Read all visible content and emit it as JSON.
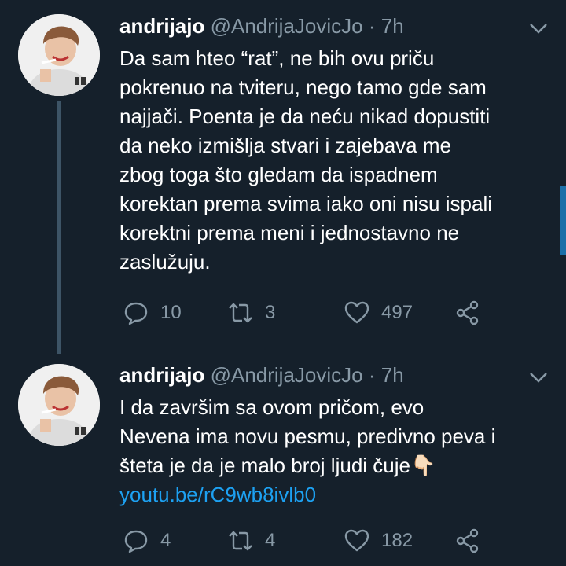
{
  "tweets": [
    {
      "name": "andrijajo",
      "handle": "@AndrijaJovicJo",
      "separator": "·",
      "time": "7h",
      "lines": [
        "Da sam hteo “rat”, ne bih ovu priču",
        "pokrenuo na tviteru, nego tamo gde sam",
        "najjači. Poenta je da neću nikad dopustiti",
        "da neko izmišlja stvari i zajebava me",
        "zbog toga što gledam da ispadnem",
        "korektan prema svima iako oni nisu ispali",
        "korektni prema meni i jednostavno ne",
        "zaslužuju."
      ],
      "replies": "10",
      "retweets": "3",
      "likes": "497"
    },
    {
      "name": "andrijajo",
      "handle": "@AndrijaJovicJo",
      "separator": "·",
      "time": "7h",
      "lines": [
        "I da završim sa ovom pričom, evo",
        "Nevena ima novu pesmu, predivno peva i",
        "šteta je da je malo broj ljudi čuje"
      ],
      "emoji": "👇🏻",
      "link": "youtu.be/rC9wb8ivlb0",
      "replies": "4",
      "retweets": "4",
      "likes": "182"
    }
  ],
  "icons": {
    "reply": "reply-icon",
    "retweet": "retweet-icon",
    "like": "heart-icon",
    "share": "share-icon",
    "menu": "chevron-down-icon"
  },
  "colors": {
    "background": "#15202b",
    "secondary_text": "#8899a6",
    "link": "#1da1f2",
    "thread_line": "#3d5466"
  }
}
